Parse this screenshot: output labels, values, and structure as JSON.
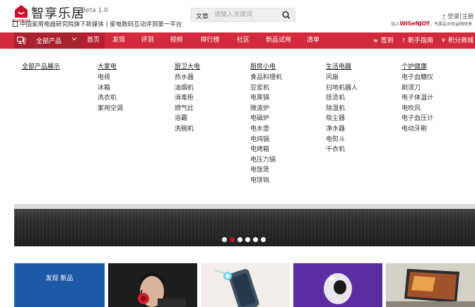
{
  "header": {
    "brand": "智享乐居",
    "logo_sub": "WISENJOY",
    "beta": "Beta 1.0",
    "tagline": "中国家用电器研究院旗下新媒体 | 家电数码互动评测第一平台",
    "search": {
      "category": "文章",
      "placeholder": "请输入关键词"
    },
    "user": {
      "login": "登录",
      "separator": "|",
      "register": "注册"
    },
    "join": {
      "prefix": "加入",
      "brand": "WISeNJOY",
      "suffix": "。专属会员权益随时享"
    }
  },
  "nav": {
    "all_products": "全部产品",
    "items": [
      {
        "label": "首页",
        "active": true
      },
      {
        "label": "发现",
        "active": false
      },
      {
        "label": "评测",
        "active": false
      },
      {
        "label": "视频",
        "active": false
      },
      {
        "label": "排行榜",
        "active": false
      },
      {
        "label": "社区",
        "active": false
      },
      {
        "label": "新品试用",
        "active": false
      },
      {
        "label": "清单",
        "active": false
      }
    ],
    "right": [
      {
        "icon": "≡",
        "label": "签到"
      },
      {
        "icon": "?",
        "label": "新手指南"
      },
      {
        "icon": "¥",
        "label": "积分商城"
      }
    ]
  },
  "mega_menu": {
    "show_all": "全部产品展示",
    "columns": [
      {
        "title": "大家电",
        "items": [
          "电视",
          "冰箱",
          "洗衣机",
          "家用空调"
        ]
      },
      {
        "title": "厨卫大电",
        "items": [
          "热水器",
          "油烟机",
          "消毒柜",
          "燃气灶",
          "浴霸",
          "洗碗机"
        ]
      },
      {
        "title": "厨房小电",
        "items": [
          "食品料理机",
          "豆浆机",
          "电蒸锅",
          "微波炉",
          "电磁炉",
          "电水壶",
          "电炖锅",
          "电烤箱",
          "电压力锅",
          "电饭煲",
          "电饼铛"
        ]
      },
      {
        "title": "生活电器",
        "items": [
          "风扇",
          "扫地机器人",
          "挂烫机",
          "除湿机",
          "吸尘器",
          "净水器",
          "电熨斗",
          "干衣机"
        ]
      },
      {
        "title": "个护健康",
        "items": [
          "电子血糖仪",
          "剃须刀",
          "电子体温计",
          "电吹风",
          "电子血压计",
          "电动牙刷"
        ]
      }
    ]
  },
  "carousel": {
    "slide_count": 6,
    "active_index": 1
  },
  "strip": {
    "discover_label": "发现 新品"
  },
  "colors": {
    "accent": "#d3293c",
    "accent_dark": "#a8232f",
    "discover_blue": "#1f5aa8"
  }
}
